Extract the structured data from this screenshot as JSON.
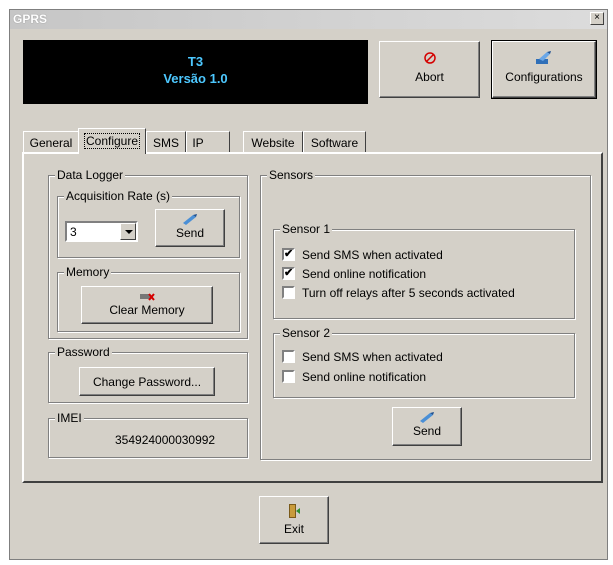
{
  "window": {
    "title": "GPRS",
    "close_glyph": "×"
  },
  "banner": {
    "line1": "T3",
    "line2": "Versão 1.0",
    "text_color": "#4dc8ff"
  },
  "toolbar": {
    "abort_label": "Abort",
    "abort_icon": "no-entry-icon",
    "config_label": "Configurations",
    "config_icon": "settings-pencil-icon"
  },
  "tabs": [
    {
      "label": "General",
      "active": false
    },
    {
      "label": "Configure",
      "active": true
    },
    {
      "label": "SMS",
      "active": false
    },
    {
      "label": "IP",
      "active": false
    },
    {
      "label": "Website",
      "active": false
    },
    {
      "label": "Software",
      "active": false
    }
  ],
  "data_logger": {
    "title": "Data Logger",
    "acquisition": {
      "title": "Acquisition Rate (s)",
      "value": "3",
      "send_label": "Send"
    },
    "memory": {
      "title": "Memory",
      "clear_label": "Clear Memory"
    }
  },
  "password": {
    "title": "Password",
    "button_label": "Change Password..."
  },
  "imei": {
    "title": "IMEI",
    "value": "354924000030992"
  },
  "sensors": {
    "title": "Sensors",
    "sensor1": {
      "title": "Sensor 1",
      "options": [
        {
          "label": "Send SMS when activated",
          "checked": true
        },
        {
          "label": "Send online notification",
          "checked": true
        },
        {
          "label": "Turn off relays after 5 seconds activated",
          "checked": false
        }
      ]
    },
    "sensor2": {
      "title": "Sensor 2",
      "options": [
        {
          "label": "Send SMS when activated",
          "checked": false
        },
        {
          "label": "Send online notification",
          "checked": false
        }
      ]
    },
    "send_label": "Send"
  },
  "footer": {
    "exit_label": "Exit"
  },
  "check_glyph": "✔"
}
